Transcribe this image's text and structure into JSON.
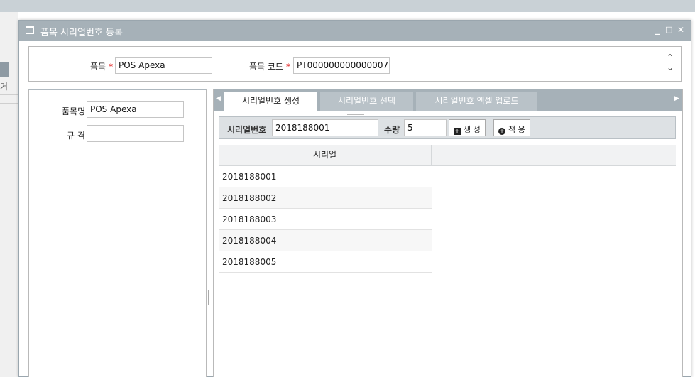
{
  "background": {
    "fragment_text": "거"
  },
  "dialog": {
    "title": "품목 시리얼번호 등록",
    "controls": {
      "minimize": "_",
      "maximize": "□",
      "close": "✕"
    }
  },
  "top_form": {
    "item_label": "품목",
    "item_value": "POS Apexa",
    "item_code_label": "품목 코드",
    "item_code_value": "PT000000000000007",
    "required_mark": "*"
  },
  "left_form": {
    "name_label": "품목명",
    "name_value": "POS Apexa",
    "spec_label": "규 격",
    "spec_value": ""
  },
  "tabs": [
    {
      "label": "시리얼번호 생성",
      "active": true
    },
    {
      "label": "시리얼번호 선택",
      "active": false
    },
    {
      "label": "시리얼번호 엑셀 업로드",
      "active": false
    }
  ],
  "toolbar": {
    "serial_label": "시리얼번호",
    "serial_value": "2018188001",
    "qty_label": "수량",
    "qty_value": "5",
    "generate_label": "생 성",
    "apply_label": "적 용"
  },
  "grid": {
    "column": "시리얼",
    "rows": [
      "2018188001",
      "2018188002",
      "2018188003",
      "2018188004",
      "2018188005"
    ]
  },
  "colors": {
    "titlebar": "#a6b1b8",
    "required": "#dd0000",
    "active_tab": "#ffffff"
  }
}
